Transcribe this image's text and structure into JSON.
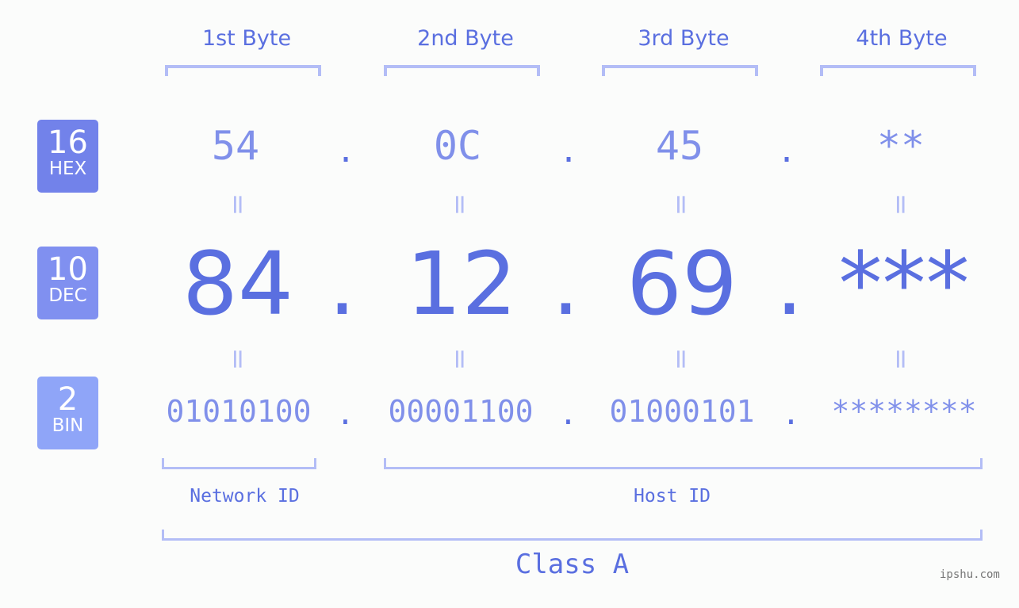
{
  "colors": {
    "accent": "#5a6fe0",
    "light_accent": "#8090ea",
    "bracket": "#b3bdf6",
    "hex_badge": "#7282ea",
    "dec_badge": "#8090f0",
    "bin_badge": "#8fa5f8",
    "background": "#fbfcfb"
  },
  "headers": [
    "1st Byte",
    "2nd Byte",
    "3rd Byte",
    "4th Byte"
  ],
  "badges": {
    "hex": {
      "num": "16",
      "label": "HEX"
    },
    "dec": {
      "num": "10",
      "label": "DEC"
    },
    "bin": {
      "num": "2",
      "label": "BIN"
    }
  },
  "hex": [
    "54",
    "0C",
    "45",
    "**"
  ],
  "dec": [
    "84",
    "12",
    "69",
    "***"
  ],
  "bin": [
    "01010100",
    "00001100",
    "01000101",
    "********"
  ],
  "separator": ".",
  "equals": "=",
  "segments": {
    "network": "Network ID",
    "host": "Host ID",
    "class": "Class A"
  },
  "watermark": "ipshu.com"
}
